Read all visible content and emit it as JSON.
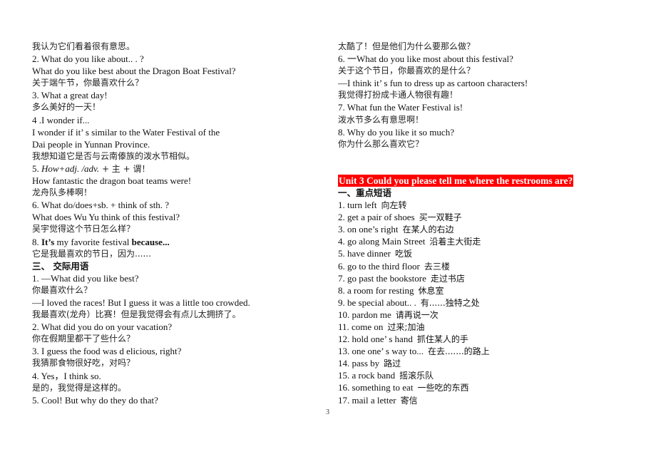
{
  "left_column": [
    {
      "text": "我认为它们看着很有意思。",
      "type": "zh"
    },
    {
      "text": "2. What do you like about.. . ?",
      "type": "en"
    },
    {
      "text": "What do you like best about the Dragon Boat Festival?",
      "type": "en"
    },
    {
      "text": "关于端午节，你最喜欢什么？",
      "type": "zh"
    },
    {
      "text": "3. What a great day!",
      "type": "en"
    },
    {
      "text": "多么美好的一天！",
      "type": "zh"
    },
    {
      "text": "4 .I wonder if...",
      "type": "en"
    },
    {
      "text": "I wonder if it’ s similar to the Water Festival of the",
      "type": "en"
    },
    {
      "text": "Dai people in Yunnan Province.",
      "type": "en"
    },
    {
      "text": "我想知道它是否与云南傣族的泼水节相似。",
      "type": "zh"
    },
    {
      "text": "5. How+adj. /adv. +  主  +  谓！",
      "type": "formula"
    },
    {
      "text": "How fantastic the dragon boat teams were!",
      "type": "en"
    },
    {
      "text": "龙舟队多棒啊！",
      "type": "zh"
    },
    {
      "text": "6. What do/does+sb. + think of sth. ?",
      "type": "en"
    },
    {
      "text": "What does Wu Yu think of this festival?",
      "type": "en"
    },
    {
      "text": "吴宇觉得这个节日怎么样？",
      "type": "zh"
    },
    {
      "text": "8. It’s my favorite festival because...",
      "type": "mixed-bold"
    },
    {
      "text": "它是我最喜欢的节日，因为......",
      "type": "zh"
    },
    {
      "text": "三、  交际用语",
      "type": "heading"
    },
    {
      "text": "1. —What did you like best?",
      "type": "en"
    },
    {
      "text": "你最喜欢什么？",
      "type": "zh"
    },
    {
      "text": "—I loved the races! But I guess it was a little too crowded.",
      "type": "en"
    },
    {
      "text": "我最喜欢(龙舟）比赛！但是我觉得会有点儿太拥挤了。",
      "type": "zh"
    },
    {
      "text": "2. What did you do on your vacation?",
      "type": "en"
    },
    {
      "text": "你在假期里都干了些什么？",
      "type": "zh"
    },
    {
      "text": "3. I guess the food was d elicious, right?",
      "type": "en"
    },
    {
      "text": "我猜那食物很好吃，对吗？",
      "type": "zh"
    },
    {
      "text": "4. Yes，I think so.",
      "type": "en"
    },
    {
      "text": "是的，我觉得是这样的。",
      "type": "zh"
    },
    {
      "text": "5. Cool! But why do they do that?",
      "type": "en"
    }
  ],
  "formula_parts": {
    "num": "5. ",
    "italic": "How+adj. /adv.",
    "rest": " +  主  +  谓！"
  },
  "bold_line_parts": {
    "num": "8. ",
    "b1": "It’s",
    "mid": " my favorite festival ",
    "b2": "because..."
  },
  "right_column_top": [
    {
      "text": "太酷了！但是他们为什么要那么做？",
      "type": "zh"
    },
    {
      "text": "6.  一What do you like most about this festival?",
      "type": "en"
    },
    {
      "text": "关于这个节日，你最喜欢的是什么？",
      "type": "zh"
    },
    {
      "text": "—I think it’ s fun to dress up as cartoon characters!",
      "type": "en"
    },
    {
      "text": "我觉得打扮成卡通人物很有趣！",
      "type": "zh"
    },
    {
      "text": "7. What fun the Water Festival is!",
      "type": "en"
    },
    {
      "text": "泼水节多么有意思啊！",
      "type": "zh"
    },
    {
      "text": "8. Why do you like it so much?",
      "type": "en"
    },
    {
      "text": "你为什么那么喜欢它？",
      "type": "zh"
    }
  ],
  "unit": {
    "title": "Unit 3 Could you please tell me where the restrooms are?",
    "highlight_color": "#ff0000",
    "section_heading": "一、重点短语"
  },
  "phrases": [
    {
      "en": "1. turn left",
      "zh": "向左转"
    },
    {
      "en": "2. get a pair of shoes",
      "zh": "买一双鞋子"
    },
    {
      "en": "3. on one’s right",
      "zh": "在某人的右边"
    },
    {
      "en": "4. go along Main Street",
      "zh": "沿着主大街走"
    },
    {
      "en": "5. have dinner",
      "zh": "吃饭"
    },
    {
      "en": "6. go to the third floor",
      "zh": "去三楼"
    },
    {
      "en": "7. go past the bookstore",
      "zh": "走过书店"
    },
    {
      "en": "8. a room for resting",
      "zh": "休息室"
    },
    {
      "en": "9. be special about.. .",
      "zh": "有......独特之处"
    },
    {
      "en": "10. pardon me",
      "zh": "请再说一次"
    },
    {
      "en": "11. come on",
      "zh": "过来;加油"
    },
    {
      "en": "12. hold one’ s hand",
      "zh": "抓住某人的手"
    },
    {
      "en": "13. one one’ s way to...",
      "zh": "在去.......的路上"
    },
    {
      "en": "14. pass by",
      "zh": "路过"
    },
    {
      "en": "15. a rock band",
      "zh": "摇滚乐队"
    },
    {
      "en": "16. something to eat",
      "zh": "一些吃的东西"
    },
    {
      "en": "17. mail a letter",
      "zh": "寄信"
    }
  ],
  "page_number": "3"
}
